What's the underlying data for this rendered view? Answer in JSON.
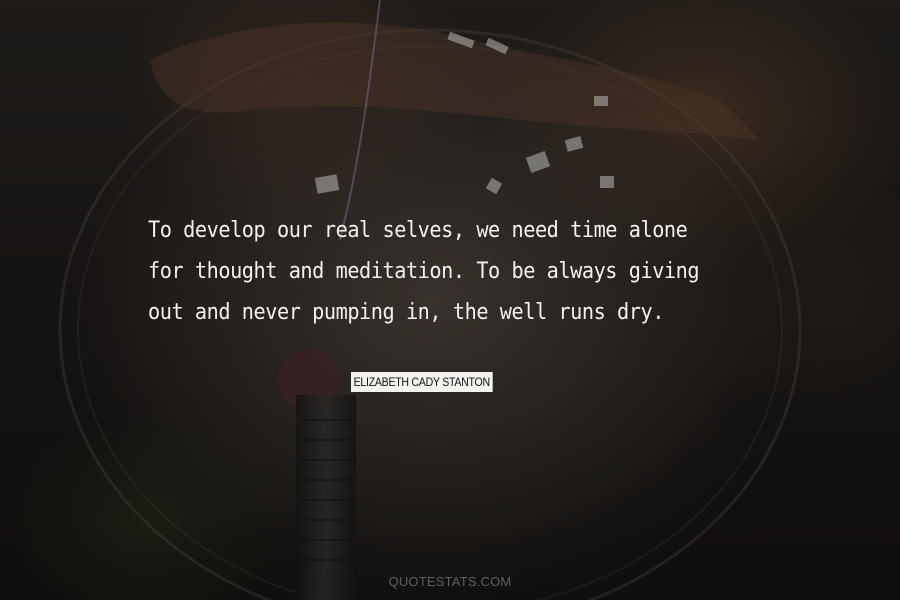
{
  "quote": {
    "lines": [
      "To develop our real selves, we need time alone",
      "for thought and meditation. To be always giving",
      "out and never pumping in, the well runs dry."
    ]
  },
  "author": {
    "name": "ELIZABETH CADY STANTON"
  },
  "watermark": {
    "text": "QUOTESTATS.COM"
  },
  "colors": {
    "quote_text": "#f3f1ec",
    "author_badge_bg": "#f4f2ee",
    "author_badge_text": "#111111",
    "background": "#1e1b19"
  }
}
